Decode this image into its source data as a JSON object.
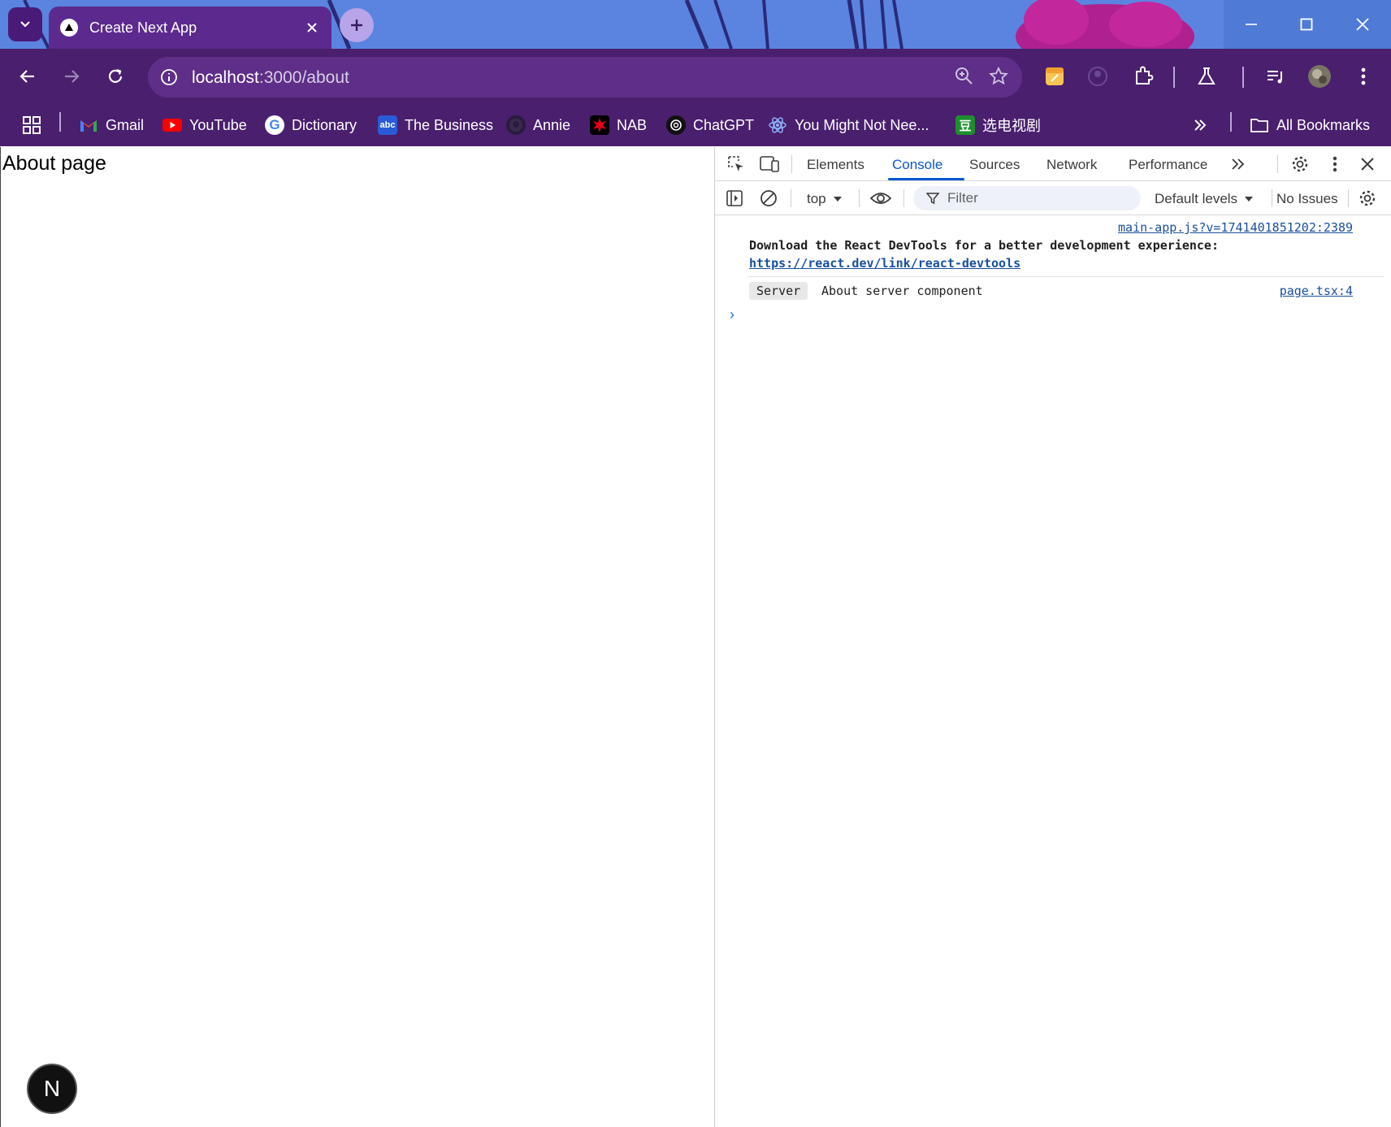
{
  "browser": {
    "tab": {
      "title": "Create Next App"
    },
    "address": {
      "host": "localhost",
      "path": ":3000/about"
    }
  },
  "bookmarks": [
    {
      "label": "Gmail",
      "icon": "gmail-icon"
    },
    {
      "label": "YouTube",
      "icon": "youtube-icon"
    },
    {
      "label": "Dictionary",
      "icon": "google-icon"
    },
    {
      "label": "The Business",
      "icon": "abc-icon"
    },
    {
      "label": "Annie",
      "icon": "github-icon"
    },
    {
      "label": "NAB",
      "icon": "nab-icon"
    },
    {
      "label": "ChatGPT",
      "icon": "chatgpt-icon"
    },
    {
      "label": "You Might Not Nee...",
      "icon": "react-icon"
    },
    {
      "label": "选电视剧",
      "icon": "douban-icon"
    }
  ],
  "all_bookmarks": "All Bookmarks",
  "page": {
    "heading": "About page",
    "badge": "N"
  },
  "devtools": {
    "tabs": [
      "Elements",
      "Console",
      "Sources",
      "Network",
      "Performance"
    ],
    "active_tab": "Console",
    "context": "top",
    "filter_placeholder": "Filter",
    "levels": "Default levels",
    "issues": "No Issues",
    "messages": [
      {
        "source": "main-app.js?v=1741401851202:2389",
        "text": "Download the React DevTools for a better development experience:",
        "link": "https://react.dev/link/react-devtools"
      },
      {
        "badge": "Server",
        "text": "About server component",
        "source": "page.tsx:4"
      }
    ],
    "prompt_symbol": "›"
  },
  "colors": {
    "tabstrip": "#5b84e0",
    "toolbar": "#4a1f6e",
    "active_tab": "#5c2a8e",
    "devtools_accent": "#0b57d0"
  }
}
